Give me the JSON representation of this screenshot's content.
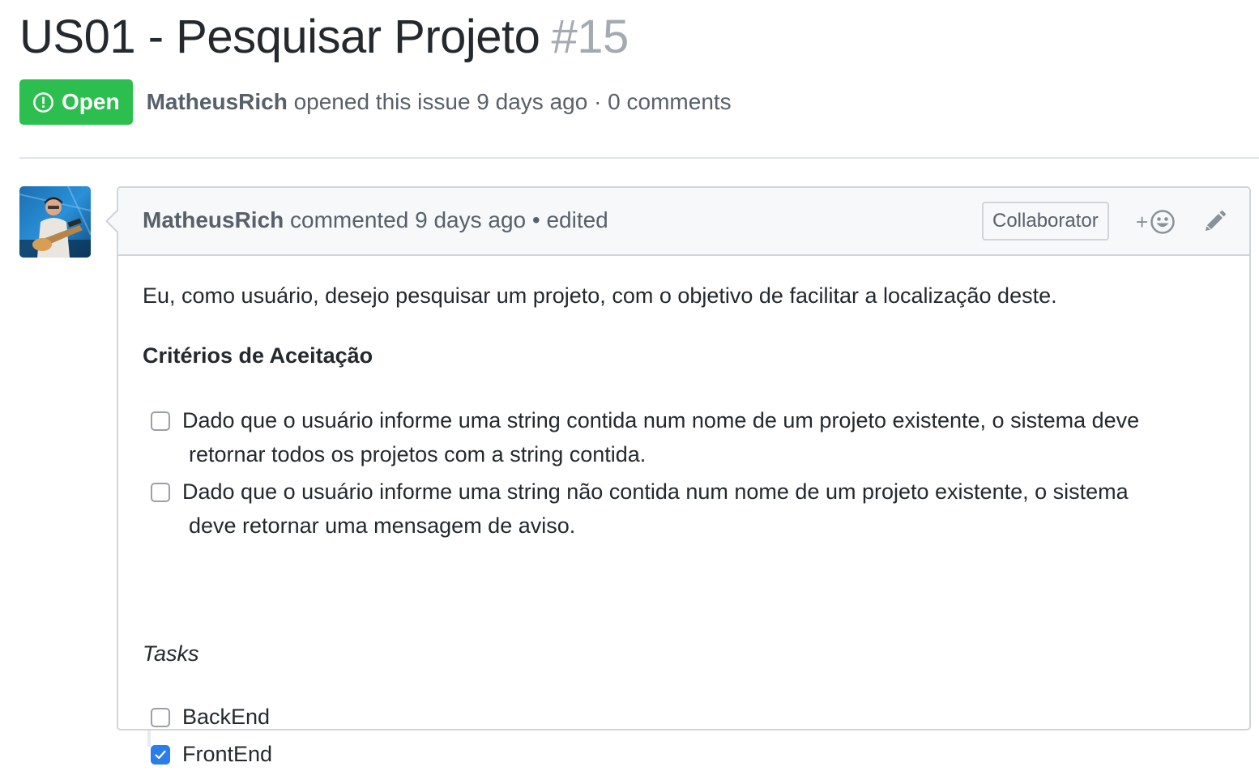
{
  "issue": {
    "title": "US01 - Pesquisar Projeto",
    "number": "#15",
    "state": "Open",
    "author": "MatheusRich",
    "opened_text": "opened this issue 9 days ago · 0 comments"
  },
  "comment": {
    "author": "MatheusRich",
    "header_text": "commented 9 days ago • edited",
    "author_association": "Collaborator",
    "reaction_plus": "+",
    "intro": "Eu, como usuário, desejo pesquisar um projeto, com o objetivo de facilitar a localização deste.",
    "criteria_heading": "Critérios de Aceitação",
    "criteria": [
      {
        "line1": "Dado que o usuário informe uma string contida num nome de um projeto existente, o sistema deve",
        "line2": "retornar todos os projetos com a string contida.",
        "checked": false
      },
      {
        "line1": "Dado que o usuário informe uma string não contida num nome de um projeto existente, o sistema",
        "line2": "deve retornar uma mensagem de aviso.",
        "checked": false
      }
    ],
    "tasks_heading": "Tasks",
    "tasks": [
      {
        "label": "BackEnd",
        "checked": false
      },
      {
        "label": "FrontEnd",
        "checked": true
      }
    ]
  },
  "icons": {
    "state": "issue-opened-icon",
    "reaction": "smiley-icon",
    "edit": "pencil-icon",
    "check": "check-icon"
  },
  "colors": {
    "open_green": "#2cbe4e",
    "checkbox_blue": "#2b7de9",
    "muted_text": "#586069",
    "issue_number": "#a3aab1"
  }
}
